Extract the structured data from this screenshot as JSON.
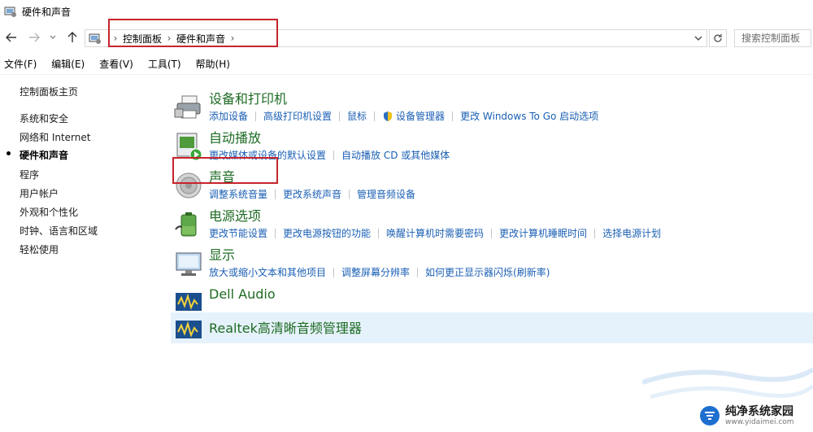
{
  "window": {
    "title": "硬件和声音"
  },
  "address": {
    "crumbs": [
      "控制面板",
      "硬件和声音"
    ],
    "search_placeholder": "搜索控制面板"
  },
  "menu": [
    "文件(F)",
    "编辑(E)",
    "查看(V)",
    "工具(T)",
    "帮助(H)"
  ],
  "sidebar": {
    "items": [
      {
        "label": "控制面板主页"
      },
      {
        "label": "系统和安全"
      },
      {
        "label": "网络和 Internet"
      },
      {
        "label": "硬件和声音"
      },
      {
        "label": "程序"
      },
      {
        "label": "用户帐户"
      },
      {
        "label": "外观和个性化"
      },
      {
        "label": "时钟、语言和区域"
      },
      {
        "label": "轻松使用"
      }
    ]
  },
  "categories": [
    {
      "title": "设备和打印机",
      "icon": "printer-icon",
      "links": [
        "添加设备",
        "高级打印机设置",
        "鼠标",
        "设备管理器",
        "更改 Windows To Go 启动选项"
      ]
    },
    {
      "title": "自动播放",
      "icon": "autoplay-icon",
      "links": [
        "更改媒体或设备的默认设置",
        "自动播放 CD 或其他媒体"
      ]
    },
    {
      "title": "声音",
      "icon": "speaker-icon",
      "links": [
        "调整系统音量",
        "更改系统声音",
        "管理音频设备"
      ]
    },
    {
      "title": "电源选项",
      "icon": "battery-icon",
      "links": [
        "更改节能设置",
        "更改电源按钮的功能",
        "唤醒计算机时需要密码",
        "更改计算机睡眠时间",
        "选择电源计划"
      ]
    },
    {
      "title": "显示",
      "icon": "monitor-icon",
      "links": [
        "放大或缩小文本和其他项目",
        "调整屏幕分辨率",
        "如何更正显示器闪烁(刷新率)"
      ]
    },
    {
      "title": "Dell Audio",
      "icon": "audio-icon",
      "links": []
    },
    {
      "title": "Realtek高清晰音频管理器",
      "icon": "audio-icon",
      "links": []
    }
  ],
  "watermark": {
    "main": "纯净系统家园",
    "url": "www.yidaimei.com"
  },
  "colors": {
    "category_title": "#1e6b23",
    "link": "#1a5fb4",
    "highlight_row": "#e6f2fb",
    "annotation_red": "#c8242c"
  }
}
